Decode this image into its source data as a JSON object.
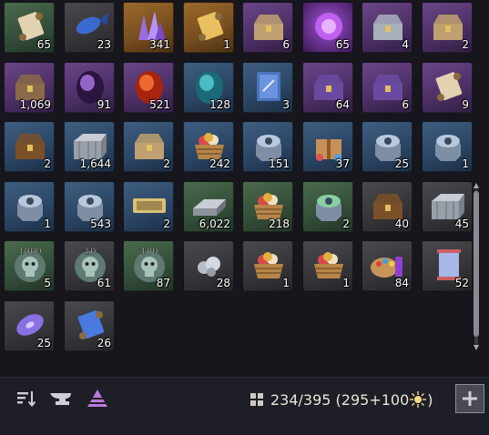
{
  "colors": {
    "accent": "#b87adc",
    "text": "#e8e4d8"
  },
  "items": [
    {
      "name": "scroll-icon",
      "count": "65",
      "rarity": "green"
    },
    {
      "name": "blue-fish-icon",
      "count": "23",
      "rarity": "grey"
    },
    {
      "name": "purple-crystal-icon",
      "count": "341",
      "rarity": "gold"
    },
    {
      "name": "golden-scroll-icon",
      "count": "1",
      "rarity": "gold"
    },
    {
      "name": "ornate-chest-icon",
      "count": "6",
      "rarity": "purple"
    },
    {
      "name": "purple-orb-icon",
      "count": "65",
      "rarity": "violet"
    },
    {
      "name": "silver-chest-icon",
      "count": "4",
      "rarity": "purple"
    },
    {
      "name": "ornate-chest-icon",
      "count": "2",
      "rarity": "purple"
    },
    {
      "name": "gem-chest-icon",
      "count": "1,069",
      "rarity": "purple"
    },
    {
      "name": "dark-egg-icon",
      "count": "91",
      "rarity": "purple"
    },
    {
      "name": "fire-egg-icon",
      "count": "521",
      "rarity": "purple"
    },
    {
      "name": "teal-egg-icon",
      "count": "128",
      "rarity": "blue"
    },
    {
      "name": "book-icon",
      "count": "3",
      "rarity": "blue"
    },
    {
      "name": "magic-chest-icon",
      "count": "64",
      "rarity": "purple"
    },
    {
      "name": "blue-magic-chest-icon",
      "count": "6",
      "rarity": "purple"
    },
    {
      "name": "parchment-scroll-icon",
      "count": "9",
      "rarity": "purple"
    },
    {
      "name": "wooden-chest-icon",
      "count": "2",
      "rarity": "blue"
    },
    {
      "name": "steel-crate-icon",
      "count": "1,644",
      "rarity": "blue"
    },
    {
      "name": "treasure-chest-icon",
      "count": "2",
      "rarity": "blue"
    },
    {
      "name": "food-basket-icon",
      "count": "242",
      "rarity": "blue"
    },
    {
      "name": "octagon-chest-icon",
      "count": "151",
      "rarity": "blue"
    },
    {
      "name": "gift-box-icon",
      "count": "37",
      "rarity": "blue"
    },
    {
      "name": "octagon-chest-icon",
      "count": "25",
      "rarity": "blue"
    },
    {
      "name": "octagon-chest-icon",
      "count": "1",
      "rarity": "blue"
    },
    {
      "name": "octagon-chest-icon",
      "count": "1",
      "rarity": "blue"
    },
    {
      "name": "compass-chest-icon",
      "count": "543",
      "rarity": "blue"
    },
    {
      "name": "ticket-icon",
      "count": "2",
      "rarity": "blue"
    },
    {
      "name": "silver-bar-icon",
      "count": "6,022",
      "rarity": "green"
    },
    {
      "name": "fruit-basket-icon",
      "count": "218",
      "rarity": "green"
    },
    {
      "name": "green-octagon-chest-icon",
      "count": "2",
      "rarity": "green"
    },
    {
      "name": "small-chest-icon",
      "count": "40",
      "rarity": "grey"
    },
    {
      "name": "food-crate-icon",
      "count": "45",
      "rarity": "grey"
    },
    {
      "name": "skull-token-icon",
      "count": "5",
      "rarity": "green",
      "label": "1000"
    },
    {
      "name": "skull-token-icon",
      "count": "61",
      "rarity": "grey",
      "label": "10"
    },
    {
      "name": "skull-token-icon",
      "count": "87",
      "rarity": "green",
      "label": "100"
    },
    {
      "name": "ore-icon",
      "count": "28",
      "rarity": "grey"
    },
    {
      "name": "picnic-basket-icon",
      "count": "1",
      "rarity": "grey"
    },
    {
      "name": "picnic-basket-icon",
      "count": "1",
      "rarity": "grey"
    },
    {
      "name": "paint-palette-icon",
      "count": "84",
      "rarity": "grey"
    },
    {
      "name": "spool-icon",
      "count": "52",
      "rarity": "grey"
    },
    {
      "name": "purple-disc-icon",
      "count": "25",
      "rarity": "grey"
    },
    {
      "name": "rainbow-scroll-icon",
      "count": "26",
      "rarity": "grey"
    }
  ],
  "toolbar": {
    "sort_icon": "sort-icon",
    "anvil_icon": "anvil-icon",
    "triangle_icon": "triangle-icon",
    "capacity_text": "234/395 (295+100",
    "capacity_close": ")",
    "add_icon": "plus-icon"
  }
}
